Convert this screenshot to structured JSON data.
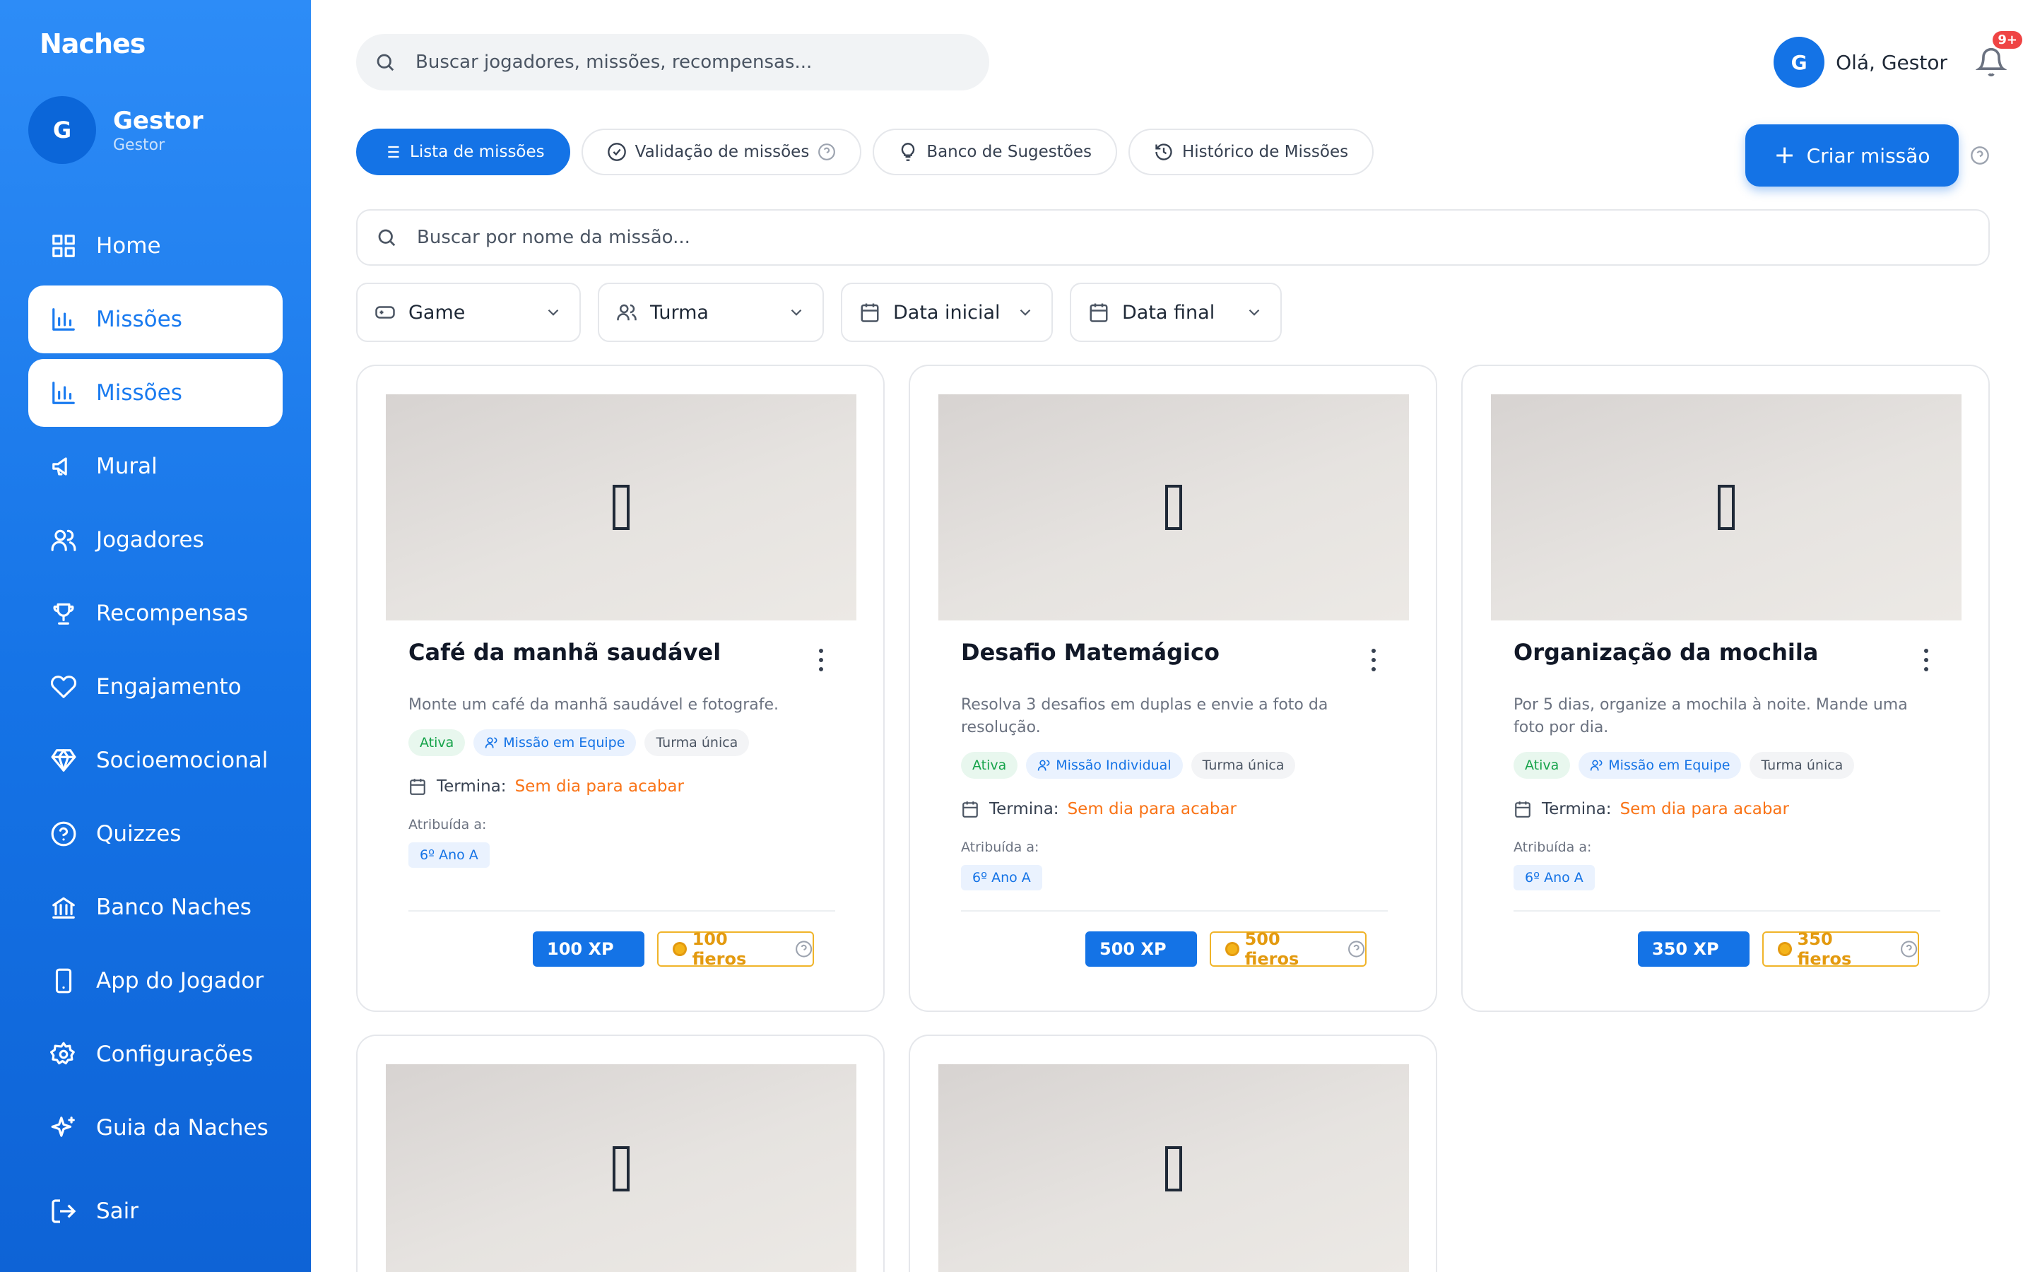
{
  "brand": {
    "logo_text": "Naches",
    "accent": "#1473e6"
  },
  "sidebar": {
    "user_initial": "G",
    "user_name": "Gestor",
    "user_role": "Gestor",
    "items": [
      {
        "label": "Home",
        "icon": "grid-icon"
      },
      {
        "label": "Missões",
        "icon": "bar-chart-icon",
        "active": true
      },
      {
        "label": "Missões",
        "icon": "bar-chart-icon",
        "active": true
      },
      {
        "label": "Mural",
        "icon": "megaphone-icon"
      },
      {
        "label": "Jogadores",
        "icon": "users-icon"
      },
      {
        "label": "Recompensas",
        "icon": "trophy-icon"
      },
      {
        "label": "Engajamento",
        "icon": "heart-icon"
      },
      {
        "label": "Socioemocional",
        "icon": "diamond-icon"
      },
      {
        "label": "Quizzes",
        "icon": "help-circle-icon"
      },
      {
        "label": "Banco Naches",
        "icon": "bank-icon"
      },
      {
        "label": "App do Jogador",
        "icon": "smartphone-icon"
      },
      {
        "label": "Configurações",
        "icon": "gear-icon"
      },
      {
        "label": "Guia da Naches",
        "icon": "sparkles-icon"
      }
    ],
    "logout_label": "Sair"
  },
  "header": {
    "search_placeholder": "Buscar jogadores, missões, recompensas...",
    "user_initial": "G",
    "greeting": "Olá, Gestor",
    "notification_badge": "9+"
  },
  "tabs": [
    {
      "label": "Lista de missões",
      "icon": "list-icon",
      "active": true
    },
    {
      "label": "Validação de missões",
      "icon": "check-circle-icon",
      "help": true
    },
    {
      "label": "Banco de Sugestões",
      "icon": "lightbulb-icon"
    },
    {
      "label": "Histórico de Missões",
      "icon": "history-icon"
    }
  ],
  "create_button_label": "Criar missão",
  "mission_search_placeholder": "Buscar por nome da missão...",
  "filters": [
    {
      "label": "Game",
      "icon": "gamepad-icon"
    },
    {
      "label": "Turma",
      "icon": "users-icon"
    },
    {
      "label": "Data inicial",
      "icon": "calendar-icon"
    },
    {
      "label": "Data final",
      "icon": "calendar-icon"
    }
  ],
  "card_labels": {
    "ends_label": "Termina:",
    "assigned_label": "Atribuída a:"
  },
  "missions": [
    {
      "title": "Café da manhã saudável",
      "description": "Monte um café da manhã saudável e fotografe.",
      "status": "Ativa",
      "type": "Missão em Equipe",
      "scope": "Turma única",
      "ends_value": "Sem dia para acabar",
      "assigned_to": "6º Ano A",
      "xp": "100 XP",
      "coins": "100 fieros"
    },
    {
      "title": "Desafio Matemágico",
      "description": "Resolva 3 desafios em duplas e envie a foto da resolução.",
      "status": "Ativa",
      "type": "Missão Individual",
      "scope": "Turma única",
      "ends_value": "Sem dia para acabar",
      "assigned_to": "6º Ano A",
      "xp": "500 XP",
      "coins": "500 fieros"
    },
    {
      "title": "Organização da mochila",
      "description": "Por 5 dias, organize a mochila à noite. Mande uma foto por dia.",
      "status": "Ativa",
      "type": "Missão em Equipe",
      "scope": "Turma única",
      "ends_value": "Sem dia para acabar",
      "assigned_to": "6º Ano A",
      "xp": "350 XP",
      "coins": "350 fieros"
    }
  ]
}
